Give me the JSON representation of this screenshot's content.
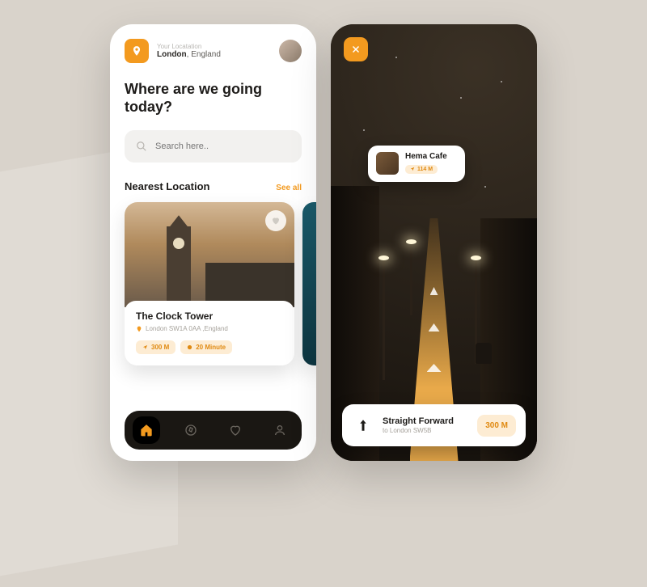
{
  "left": {
    "location_label": "Your Locatation",
    "location_city": "London",
    "location_country": ", England",
    "hero": "Where are we going today?",
    "search_placeholder": "Search here..",
    "section_title": "Nearest Location",
    "see_all": "See all",
    "card": {
      "title": "The Clock Tower",
      "address": "London SW1A 0AA ,England",
      "distance": "300 M",
      "time": "20 Minute"
    }
  },
  "right": {
    "poi": {
      "title": "Hema Cafe",
      "distance": "114 M"
    },
    "direction": {
      "title": "Straight Forward",
      "subtitle": "to London SW5B",
      "distance": "300 M"
    }
  }
}
